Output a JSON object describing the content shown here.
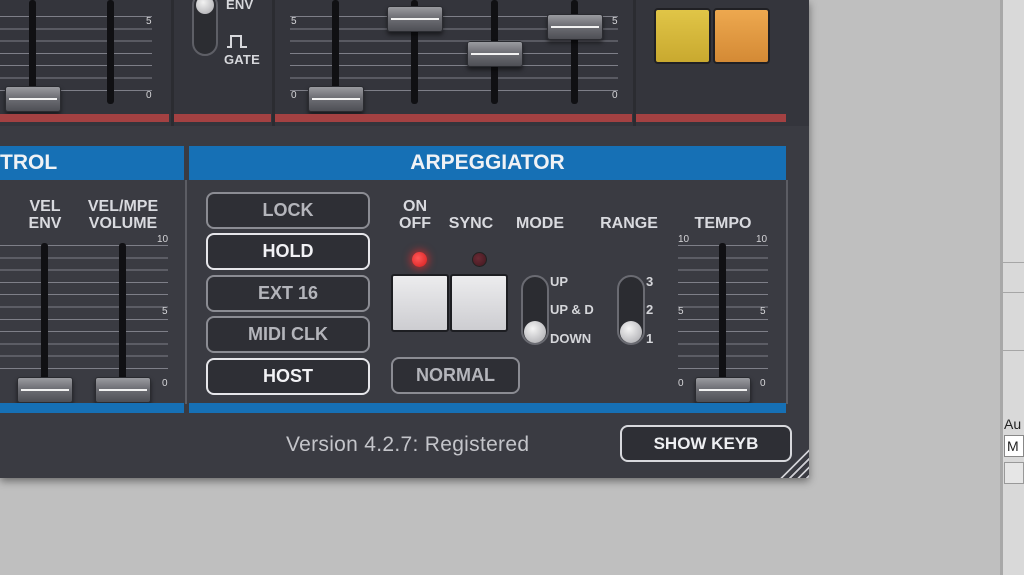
{
  "host": {
    "au_label": "Au",
    "field_value": "M"
  },
  "top_panel": {
    "env_label": "ENV",
    "gate_label": "GATE",
    "scale_left": {
      "mid": "5",
      "low": "0"
    },
    "scale_right": {
      "mid": "5",
      "low": "0",
      "low_left": "0",
      "mid_left": "5"
    },
    "pads": [
      {
        "color": "#d8b83c"
      },
      {
        "color": "#e2973f"
      }
    ]
  },
  "control_section": {
    "header": "TROL",
    "vel_env_label": "VEL\nENV",
    "vel_mpe_label": "VEL/MPE\nVOLUME",
    "scale": {
      "top": "10",
      "mid": "5",
      "low": "0"
    }
  },
  "arpeggiator": {
    "header": "ARPEGGIATOR",
    "mode_buttons": [
      {
        "label": "LOCK",
        "active": false
      },
      {
        "label": "HOLD",
        "active": true
      },
      {
        "label": "EXT 16",
        "active": false
      },
      {
        "label": "MIDI CLK",
        "active": false
      },
      {
        "label": "HOST",
        "active": true
      }
    ],
    "on_off_label": "ON\nOFF",
    "sync_label": "SYNC",
    "mode_label": "MODE",
    "range_label": "RANGE",
    "tempo_label": "TEMPO",
    "on_led": true,
    "sync_led": false,
    "mode_options": [
      "UP",
      "UP & D",
      "DOWN"
    ],
    "mode_selected": "DOWN",
    "range_options": [
      "3",
      "2",
      "1"
    ],
    "range_selected": "1",
    "normal_label": "NORMAL",
    "tempo_scale": {
      "top_left": "10",
      "top_right": "10",
      "mid_left": "5",
      "mid_right": "5",
      "low_left": "0",
      "low_right": "0"
    }
  },
  "footer": {
    "version_text": "Version 4.2.7: Registered",
    "show_keyb_label": "SHOW KEYB"
  }
}
